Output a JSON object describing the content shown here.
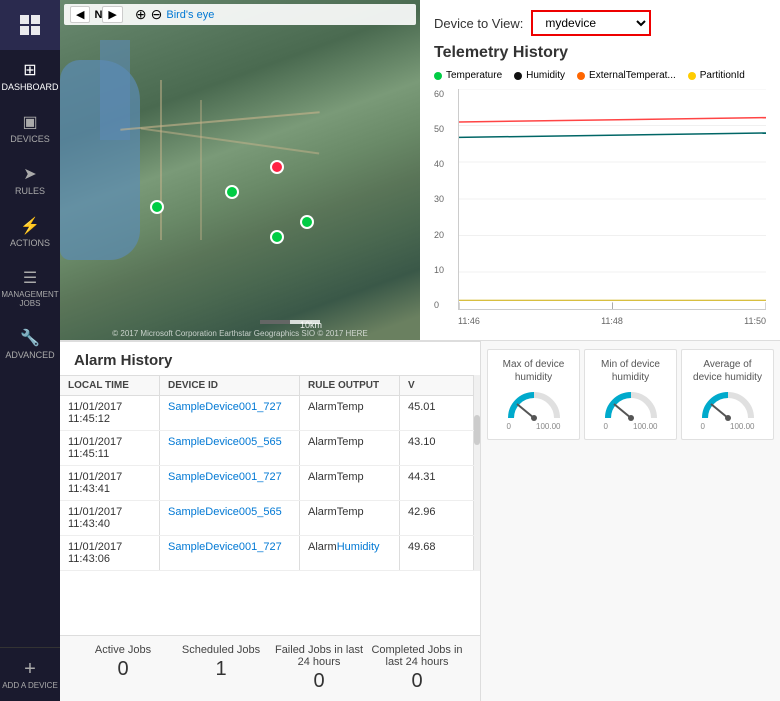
{
  "sidebar": {
    "logo_icon": "grid-icon",
    "items": [
      {
        "id": "dashboard",
        "label": "DASHBOARD",
        "icon": "■"
      },
      {
        "id": "devices",
        "label": "DEVICES",
        "icon": "⊡"
      },
      {
        "id": "rules",
        "label": "RULES",
        "icon": "→"
      },
      {
        "id": "actions",
        "label": "ACTIONS",
        "icon": "⚡"
      },
      {
        "id": "management-jobs",
        "label": "MANAGEMENT JOBS",
        "icon": "≡"
      },
      {
        "id": "advanced",
        "label": "ADVANCED",
        "icon": "🔧"
      }
    ],
    "add_device_label": "ADD A DEVICE"
  },
  "map": {
    "toolbar": {
      "nav_label": "N",
      "view_label": "Bird's eye"
    },
    "watermark": "© 2017 Microsoft Corporation   Earthstar Geographics SIO © 2017 HERE"
  },
  "telemetry": {
    "device_view_label": "Device to View:",
    "device_select_value": "mydevice",
    "title": "Telemetry History",
    "legend": [
      {
        "label": "Temperature",
        "color": "#00cc44"
      },
      {
        "label": "Humidity",
        "color": "#111111"
      },
      {
        "label": "ExternalTemperat...",
        "color": "#ff6600"
      },
      {
        "label": "PartitionId",
        "color": "#ffcc00"
      }
    ],
    "y_labels": [
      "60",
      "50",
      "40",
      "30",
      "20",
      "10",
      "0"
    ],
    "x_labels": [
      "11:46",
      "11:48",
      "11:50"
    ],
    "lines": [
      {
        "id": "temperature",
        "color": "#ff4444",
        "y_pct": 15
      },
      {
        "id": "humidity",
        "color": "#006666",
        "y_pct": 22
      },
      {
        "id": "external",
        "color": "#ff8800",
        "y_pct": 55
      },
      {
        "id": "partition",
        "color": "#ccaa00",
        "y_pct": 95
      }
    ]
  },
  "alarm": {
    "title": "Alarm History",
    "columns": [
      "LOCAL TIME",
      "DEVICE ID",
      "RULE OUTPUT",
      "V"
    ],
    "rows": [
      {
        "time": "11/01/2017\n11:45:12",
        "device": "SampleDevice001_727",
        "rule": "AlarmTemp",
        "value": "45.01"
      },
      {
        "time": "11/01/2017\n11:45:11",
        "device": "SampleDevice005_565",
        "rule": "AlarmTemp",
        "value": "43.10"
      },
      {
        "time": "11/01/2017\n11:43:41",
        "device": "SampleDevice001_727",
        "rule": "AlarmTemp",
        "value": "44.31"
      },
      {
        "time": "11/01/2017\n11:43:40",
        "device": "SampleDevice005_565",
        "rule": "AlarmTemp",
        "value": "42.96"
      },
      {
        "time": "11/01/2017\n11:43:06",
        "device": "SampleDevice001_727",
        "rule": "AlarmHumidity",
        "value": "49.68"
      }
    ]
  },
  "jobs": [
    {
      "label": "Active Jobs",
      "value": "0"
    },
    {
      "label": "Scheduled Jobs",
      "value": "1"
    },
    {
      "label": "Failed Jobs in last 24 hours",
      "value": "0"
    },
    {
      "label": "Completed Jobs in last 24 hours",
      "value": "0"
    }
  ],
  "humidity_widgets": [
    {
      "title": "Max of device humidity",
      "min_label": "0",
      "max_label": "100.00",
      "needle_angle": -80
    },
    {
      "title": "Min of device humidity",
      "min_label": "0",
      "max_label": "100.00",
      "needle_angle": -80
    },
    {
      "title": "Average of device humidity",
      "min_label": "0",
      "max_label": "100.00",
      "needle_angle": -80
    }
  ]
}
